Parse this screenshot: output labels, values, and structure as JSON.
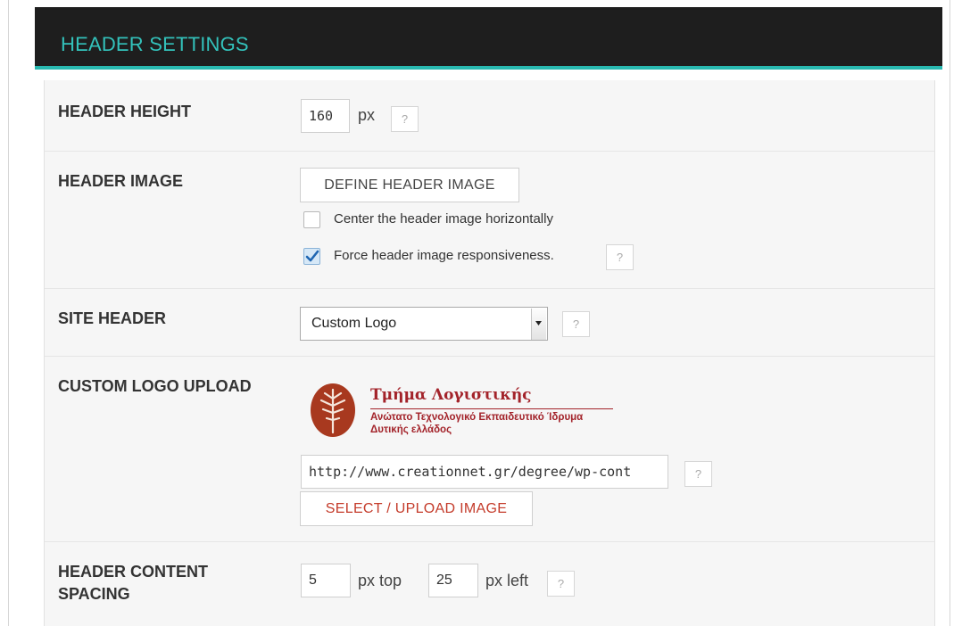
{
  "panel": {
    "title": "HEADER SETTINGS"
  },
  "colors": {
    "header_bg": "#1e1e1e",
    "accent": "#33c2bb",
    "accent_border": "#28b8b0",
    "logo_red": "#a3232a",
    "upload_red": "#c43b2a"
  },
  "header_height": {
    "label": "HEADER HEIGHT",
    "value": "160",
    "unit": "px",
    "help": "?"
  },
  "header_image": {
    "label": "HEADER IMAGE",
    "button": "DEFINE HEADER IMAGE",
    "center_option": {
      "label": "Center the header image horizontally",
      "checked": false
    },
    "responsive_option": {
      "label": "Force header image responsiveness.",
      "checked": true
    },
    "help": "?"
  },
  "site_header": {
    "label": "SITE HEADER",
    "selected": "Custom Logo",
    "help": "?"
  },
  "custom_logo": {
    "label": "CUSTOM LOGO UPLOAD",
    "logo": {
      "name": "Τμήμα Λογιστικής",
      "line1": "Ανώτατο Τεχνολογικό Εκπαιδευτικό Ίδρυμα",
      "line2": "Δυτικής ελλάδος"
    },
    "url": "http://www.creationnet.gr/degree/wp-cont",
    "upload_button": "SELECT / UPLOAD IMAGE",
    "help": "?"
  },
  "content_spacing": {
    "label": "HEADER CONTENT SPACING",
    "top_value": "5",
    "top_unit": "px top",
    "left_value": "25",
    "left_unit": "px left",
    "help": "?"
  }
}
